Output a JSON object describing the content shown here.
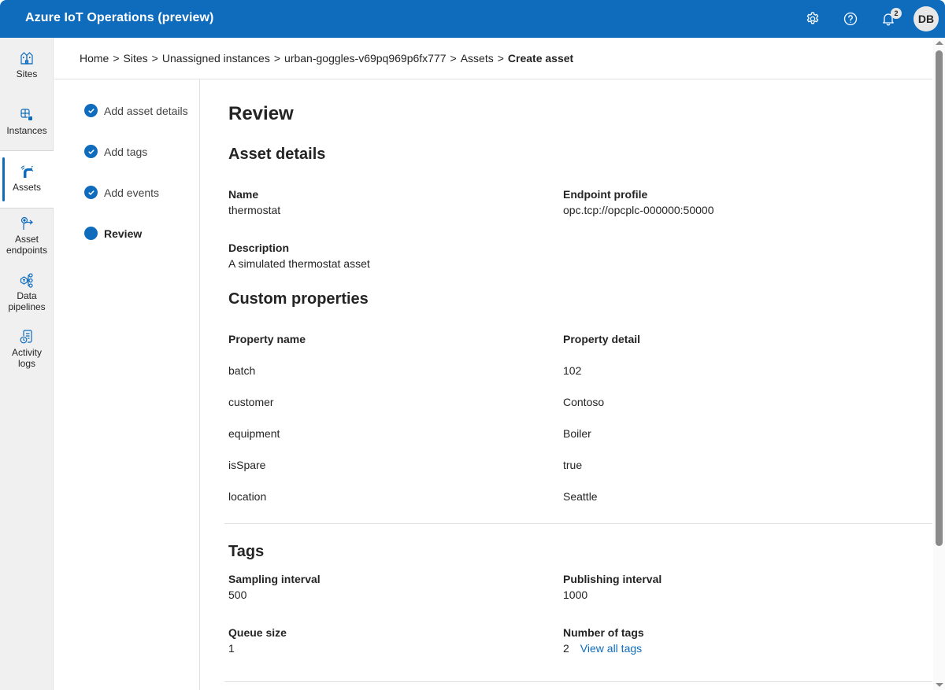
{
  "app": {
    "title": "Azure IoT Operations (preview)",
    "brand_color": "#0f6cbd"
  },
  "header": {
    "settings_icon": "gear-icon",
    "help_icon": "help-circle-icon",
    "notifications_icon": "bell-icon",
    "notification_count": "2",
    "avatar_initials": "DB"
  },
  "sidebar": {
    "items": [
      {
        "label": "Sites",
        "icon": "buildings-icon",
        "active": false
      },
      {
        "label": "Instances",
        "icon": "instances-icon",
        "active": false
      },
      {
        "label": "Assets",
        "icon": "asset-icon",
        "active": true
      },
      {
        "label_line1": "Asset",
        "label_line2": "endpoints",
        "icon": "asset-endpoint-icon",
        "active": false
      },
      {
        "label_line1": "Data",
        "label_line2": "pipelines",
        "icon": "pipeline-icon",
        "active": false
      },
      {
        "label_line1": "Activity",
        "label_line2": "logs",
        "icon": "activity-log-icon",
        "active": false
      }
    ]
  },
  "breadcrumb": {
    "items": [
      "Home",
      "Sites",
      "Unassigned instances",
      "urban-goggles-v69pq969p6fx777",
      "Assets"
    ],
    "current": "Create asset",
    "separator": ">"
  },
  "steps": [
    {
      "label": "Add asset details",
      "status": "completed"
    },
    {
      "label": "Add tags",
      "status": "completed"
    },
    {
      "label": "Add events",
      "status": "completed"
    },
    {
      "label": "Review",
      "status": "current"
    }
  ],
  "review": {
    "title": "Review",
    "asset_details": {
      "heading": "Asset details",
      "name_label": "Name",
      "name_value": "thermostat",
      "endpoint_label": "Endpoint profile",
      "endpoint_value": "opc.tcp://opcplc-000000:50000",
      "description_label": "Description",
      "description_value": "A simulated thermostat asset"
    },
    "custom_properties": {
      "heading": "Custom properties",
      "columns": [
        "Property name",
        "Property detail"
      ],
      "rows": [
        {
          "name": "batch",
          "detail": "102"
        },
        {
          "name": "customer",
          "detail": "Contoso"
        },
        {
          "name": "equipment",
          "detail": "Boiler"
        },
        {
          "name": "isSpare",
          "detail": "true"
        },
        {
          "name": "location",
          "detail": "Seattle"
        }
      ]
    },
    "tags": {
      "heading": "Tags",
      "sampling_label": "Sampling interval",
      "sampling_value": "500",
      "publishing_label": "Publishing interval",
      "publishing_value": "1000",
      "queue_label": "Queue size",
      "queue_value": "1",
      "count_label": "Number of tags",
      "count_value": "2",
      "view_all_link": "View all tags"
    }
  }
}
